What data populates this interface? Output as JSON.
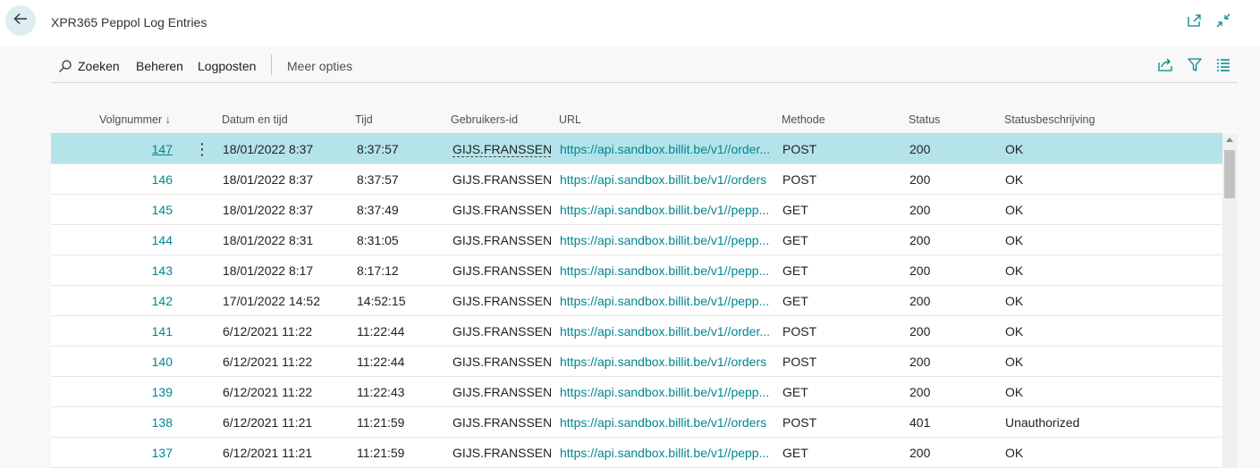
{
  "window": {
    "title": "XPR365 Peppol Log Entries",
    "back_icon": "arrow-left-icon",
    "open_new_icon": "open-in-new-window-icon",
    "collapse_icon": "collapse-icon"
  },
  "actions": {
    "search_label": "Zoeken",
    "manage_label": "Beheren",
    "post_log_label": "Logposten",
    "more_options_label": "Meer opties",
    "icons": [
      "share-icon",
      "filter-icon",
      "list-view-icon"
    ]
  },
  "columns": {
    "number": "Volgnummer",
    "sort_indicator": "↓",
    "datetime": "Datum en tijd",
    "time": "Tijd",
    "user": "Gebruikers-id",
    "url": "URL",
    "method": "Methode",
    "status": "Status",
    "status_description": "Statusbeschrijving"
  },
  "rows": [
    {
      "number": "147",
      "datetime": "18/01/2022 8:37",
      "time": "8:37:57",
      "user": "GIJS.FRANSSENS",
      "url": "https://api.sandbox.billit.be/v1//order...",
      "method": "POST",
      "status": "200",
      "description": "OK"
    },
    {
      "number": "146",
      "datetime": "18/01/2022 8:37",
      "time": "8:37:57",
      "user": "GIJS.FRANSSENS",
      "url": "https://api.sandbox.billit.be/v1//orders",
      "method": "POST",
      "status": "200",
      "description": "OK"
    },
    {
      "number": "145",
      "datetime": "18/01/2022 8:37",
      "time": "8:37:49",
      "user": "GIJS.FRANSSENS",
      "url": "https://api.sandbox.billit.be/v1//pepp...",
      "method": "GET",
      "status": "200",
      "description": "OK"
    },
    {
      "number": "144",
      "datetime": "18/01/2022 8:31",
      "time": "8:31:05",
      "user": "GIJS.FRANSSENS",
      "url": "https://api.sandbox.billit.be/v1//pepp...",
      "method": "GET",
      "status": "200",
      "description": "OK"
    },
    {
      "number": "143",
      "datetime": "18/01/2022 8:17",
      "time": "8:17:12",
      "user": "GIJS.FRANSSENS",
      "url": "https://api.sandbox.billit.be/v1//pepp...",
      "method": "GET",
      "status": "200",
      "description": "OK"
    },
    {
      "number": "142",
      "datetime": "17/01/2022 14:52",
      "time": "14:52:15",
      "user": "GIJS.FRANSSENS",
      "url": "https://api.sandbox.billit.be/v1//pepp...",
      "method": "GET",
      "status": "200",
      "description": "OK"
    },
    {
      "number": "141",
      "datetime": "6/12/2021 11:22",
      "time": "11:22:44",
      "user": "GIJS.FRANSSENS",
      "url": "https://api.sandbox.billit.be/v1//order...",
      "method": "POST",
      "status": "200",
      "description": "OK"
    },
    {
      "number": "140",
      "datetime": "6/12/2021 11:22",
      "time": "11:22:44",
      "user": "GIJS.FRANSSENS",
      "url": "https://api.sandbox.billit.be/v1//orders",
      "method": "POST",
      "status": "200",
      "description": "OK"
    },
    {
      "number": "139",
      "datetime": "6/12/2021 11:22",
      "time": "11:22:43",
      "user": "GIJS.FRANSSENS",
      "url": "https://api.sandbox.billit.be/v1//pepp...",
      "method": "GET",
      "status": "200",
      "description": "OK"
    },
    {
      "number": "138",
      "datetime": "6/12/2021 11:21",
      "time": "11:21:59",
      "user": "GIJS.FRANSSENS",
      "url": "https://api.sandbox.billit.be/v1//orders",
      "method": "POST",
      "status": "401",
      "description": "Unauthorized"
    },
    {
      "number": "137",
      "datetime": "6/12/2021 11:21",
      "time": "11:21:59",
      "user": "GIJS.FRANSSENS",
      "url": "https://api.sandbox.billit.be/v1//pepp...",
      "method": "GET",
      "status": "200",
      "description": "OK"
    }
  ],
  "selected_row_index": 0,
  "row_menu_icon": "more-vertical-icon",
  "colors": {
    "accent": "#00858f",
    "selected_row": "#b4e4ea",
    "back_button_bg": "#dceef1"
  }
}
